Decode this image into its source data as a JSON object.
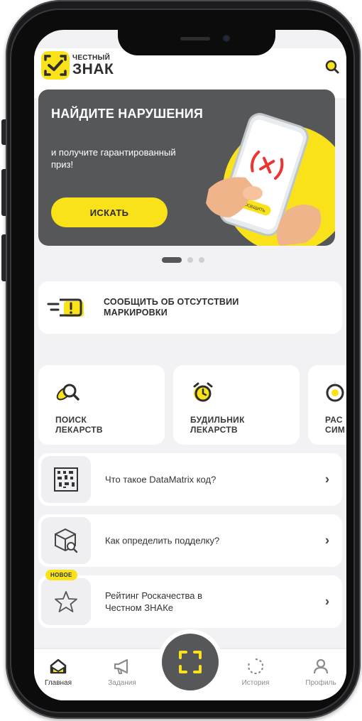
{
  "header": {
    "logo_small": "ЧЕСТНЫЙ",
    "logo_big": "ЗНАК"
  },
  "banner": {
    "title": "НАЙДИТЕ НАРУШЕНИЯ",
    "text": "и получите гарантированный приз!",
    "button_label": "ИСКАТЬ",
    "phone_button": "СООБЩИТЬ"
  },
  "carousel": {
    "pages": 3,
    "active": 1
  },
  "report": {
    "label": "СООБЩИТЬ ОБ ОТСУТСТВИИ\nМАРКИРОВКИ"
  },
  "services": [
    {
      "label": "ПОИСК\nЛЕКАРСТВ",
      "icon": "pill-search-icon"
    },
    {
      "label": "БУДИЛЬНИК\nЛЕКАРСТВ",
      "icon": "alarm-clock-icon"
    },
    {
      "label": "РАС\nСИМ",
      "icon": "partial-service-icon"
    }
  ],
  "list": [
    {
      "label": "Что такое DataMatrix код?",
      "icon": "datamatrix-icon",
      "badge": ""
    },
    {
      "label": "Как определить подделку?",
      "icon": "box-search-icon",
      "badge": ""
    },
    {
      "label": "Рейтинг Роскачества в\nЧестном ЗНАКе",
      "icon": "star-icon",
      "badge": "НОВОЕ"
    }
  ],
  "nav": {
    "home": "Главная",
    "tasks": "Задания",
    "history": "История",
    "profile": "Профиль"
  },
  "colors": {
    "accent": "#f9e21a",
    "dark": "#555759",
    "text": "#2e2e2e"
  }
}
